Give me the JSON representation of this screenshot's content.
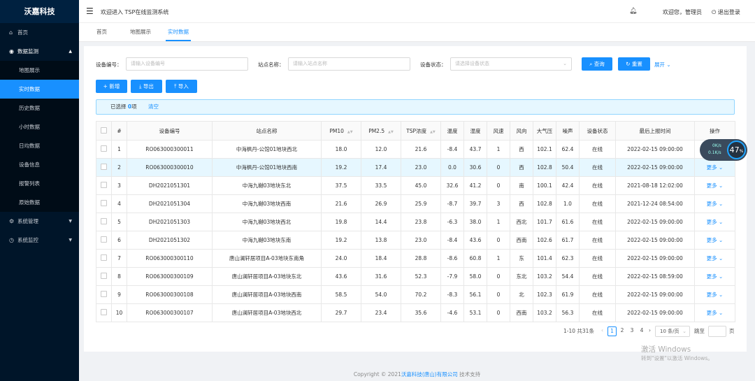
{
  "brand": "沃嘉科技",
  "sidebar": {
    "home": "首页",
    "monitor": "数据监测",
    "sub": [
      "地图展示",
      "实时数据",
      "历史数据",
      "小时数据",
      "日均数据",
      "设备信息",
      "报警列表",
      "原始数据"
    ],
    "system": "系统管理",
    "sysmon": "系统监控"
  },
  "header": {
    "welcome": "欢迎进入 TSP在线监测系统",
    "hello": "欢迎您，管理员",
    "logout": "退出登录"
  },
  "tabs": [
    "首页",
    "地图展示",
    "实时数据"
  ],
  "filters": {
    "device_label": "设备编号：",
    "device_ph": "请输入设备编号",
    "station_label": "站点名称：",
    "station_ph": "请输入站点名称",
    "status_label": "设备状态：",
    "status_ph": "请选择设备状态",
    "search": "查询",
    "reset": "重置",
    "expand": "展开"
  },
  "toolbar": {
    "add": "新增",
    "export": "导出",
    "import": "导入"
  },
  "selection": {
    "prefix": "已选择 ",
    "count": "0",
    "suffix": "项",
    "clear": "清空"
  },
  "table": {
    "headers": [
      "#",
      "设备编号",
      "站点名称",
      "PM10",
      "PM2.5",
      "TSP浓度",
      "温度",
      "湿度",
      "风速",
      "风向",
      "大气压",
      "噪声",
      "设备状态",
      "最后上报时间",
      "操作"
    ],
    "more": "更多",
    "rows": [
      [
        "1",
        "RO063000300011",
        "中海枫丹-公馆01地块西北",
        "18.0",
        "12.0",
        "21.6",
        "-8.4",
        "43.7",
        "1",
        "西",
        "102.1",
        "62.4",
        "在线",
        "2022-02-15 09:00:00"
      ],
      [
        "2",
        "RO063000300010",
        "中海枫丹-公馆01地块西南",
        "19.2",
        "17.4",
        "23.0",
        "0.0",
        "30.6",
        "0",
        "西",
        "102.8",
        "50.4",
        "在线",
        "2022-02-15 09:00:00"
      ],
      [
        "3",
        "DH2021051301",
        "中海九樾03地块东北",
        "37.5",
        "33.5",
        "45.0",
        "32.6",
        "41.2",
        "0",
        "南",
        "100.1",
        "42.4",
        "在线",
        "2021-08-18 12:02:00"
      ],
      [
        "4",
        "DH2021051304",
        "中海九樾03地块西南",
        "21.6",
        "26.9",
        "25.9",
        "-8.7",
        "39.7",
        "3",
        "西",
        "102.8",
        "1.0",
        "在线",
        "2021-12-24 08:54:00"
      ],
      [
        "5",
        "DH2021051303",
        "中海九樾03地块西北",
        "19.8",
        "14.4",
        "23.8",
        "-6.3",
        "38.0",
        "1",
        "西北",
        "101.7",
        "61.6",
        "在线",
        "2022-02-15 09:00:00"
      ],
      [
        "6",
        "DH2021051302",
        "中海九樾03地块东南",
        "19.2",
        "13.8",
        "23.0",
        "-8.4",
        "43.6",
        "0",
        "西南",
        "102.6",
        "61.7",
        "在线",
        "2022-02-15 09:00:00"
      ],
      [
        "7",
        "RO063000300110",
        "唐山澜轩居项目A-03地块东南角",
        "24.0",
        "18.4",
        "28.8",
        "-8.6",
        "60.8",
        "1",
        "东",
        "101.4",
        "62.3",
        "在线",
        "2022-02-15 09:00:00"
      ],
      [
        "8",
        "RO063000300109",
        "唐山澜轩居项目A-03地块东北",
        "43.6",
        "31.6",
        "52.3",
        "-7.9",
        "58.0",
        "0",
        "东北",
        "103.2",
        "54.4",
        "在线",
        "2022-02-15 08:59:00"
      ],
      [
        "9",
        "RO063000300108",
        "唐山澜轩居项目A-03地块西南",
        "58.5",
        "54.0",
        "70.2",
        "-8.3",
        "56.1",
        "0",
        "北",
        "102.3",
        "61.9",
        "在线",
        "2022-02-15 09:00:00"
      ],
      [
        "10",
        "RO063000300107",
        "唐山澜轩居项目A-03地块西北",
        "29.7",
        "23.4",
        "35.6",
        "-4.6",
        "53.1",
        "0",
        "西南",
        "103.2",
        "56.3",
        "在线",
        "2022-02-15 09:00:00"
      ]
    ]
  },
  "pager": {
    "total": "1-10 共31条",
    "pages": [
      "1",
      "2",
      "3",
      "4"
    ],
    "size": "10 条/页",
    "goto": "跳至",
    "page_unit": "页"
  },
  "footer": {
    "pre": "Copyright © 2021",
    "company": "沃嘉科技(唐山)有限公司",
    "post": " 技术支持"
  },
  "widget": {
    "pct": "47",
    "unit": "%",
    "up": "0K/s",
    "down": "0.1K/s"
  },
  "watermark": {
    "line1": "激活 Windows",
    "line2": "转到\"设置\"以激活 Windows。"
  },
  "colors": {
    "primary": "#1890ff",
    "sidebar": "#001529"
  }
}
